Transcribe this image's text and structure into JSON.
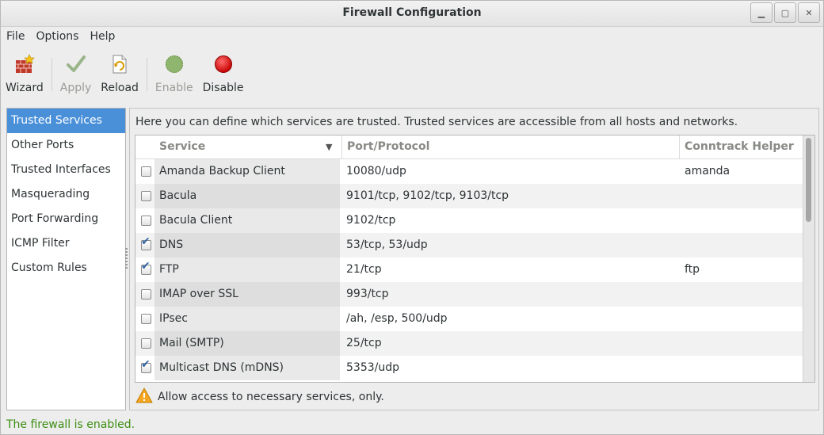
{
  "window": {
    "title": "Firewall Configuration"
  },
  "menubar": {
    "items": [
      "File",
      "Options",
      "Help"
    ]
  },
  "toolbar": {
    "wizard": "Wizard",
    "apply": "Apply",
    "reload": "Reload",
    "enable": "Enable",
    "disable": "Disable"
  },
  "sidebar": {
    "items": [
      {
        "label": "Trusted Services",
        "active": true
      },
      {
        "label": "Other Ports"
      },
      {
        "label": "Trusted Interfaces"
      },
      {
        "label": "Masquerading"
      },
      {
        "label": "Port Forwarding"
      },
      {
        "label": "ICMP Filter"
      },
      {
        "label": "Custom Rules"
      }
    ]
  },
  "panel": {
    "description": "Here you can define which services are trusted. Trusted services are accessible from all hosts and networks.",
    "columns": [
      "Service",
      "Port/Protocol",
      "Conntrack Helper"
    ],
    "rows": [
      {
        "checked": false,
        "service": "Amanda Backup Client",
        "port": "10080/udp",
        "helper": "amanda"
      },
      {
        "checked": false,
        "service": "Bacula",
        "port": "9101/tcp, 9102/tcp, 9103/tcp",
        "helper": ""
      },
      {
        "checked": false,
        "service": "Bacula Client",
        "port": "9102/tcp",
        "helper": ""
      },
      {
        "checked": true,
        "service": "DNS",
        "port": "53/tcp, 53/udp",
        "helper": ""
      },
      {
        "checked": true,
        "service": "FTP",
        "port": "21/tcp",
        "helper": "ftp"
      },
      {
        "checked": false,
        "service": "IMAP over SSL",
        "port": "993/tcp",
        "helper": ""
      },
      {
        "checked": false,
        "service": "IPsec",
        "port": "/ah, /esp, 500/udp",
        "helper": ""
      },
      {
        "checked": false,
        "service": "Mail (SMTP)",
        "port": "25/tcp",
        "helper": ""
      },
      {
        "checked": true,
        "service": "Multicast DNS (mDNS)",
        "port": "5353/udp",
        "helper": ""
      }
    ],
    "notice": "Allow access to necessary services, only."
  },
  "status": "The firewall is enabled.",
  "colors": {
    "accent": "#4a90d9",
    "status_ok": "#3b8d12"
  }
}
